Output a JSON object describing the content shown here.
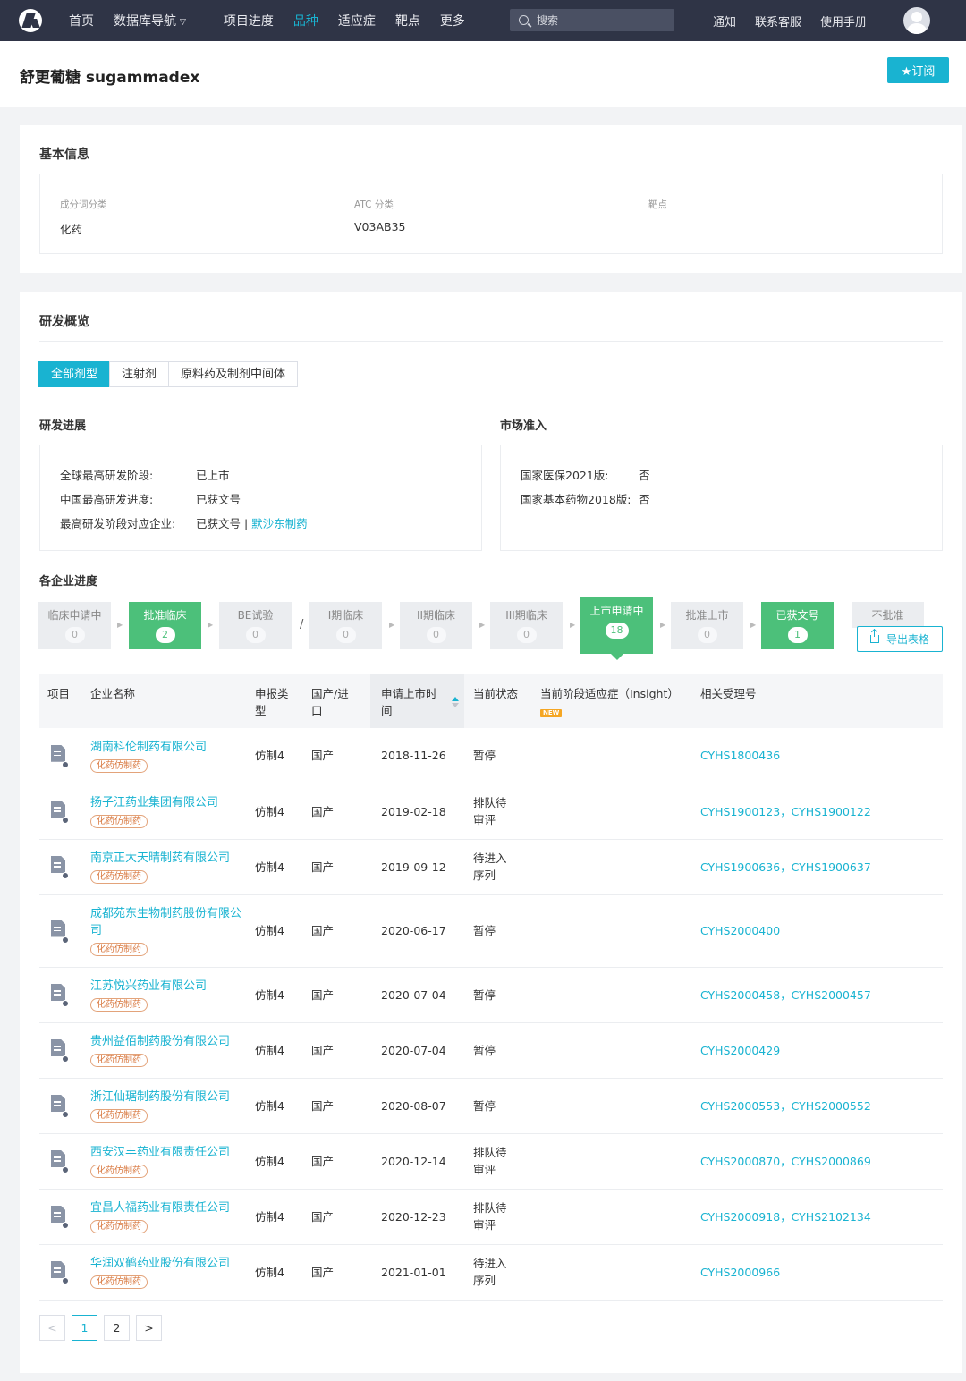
{
  "nav": {
    "items": [
      "首页",
      "数据库导航",
      "项目进度",
      "品种",
      "适应症",
      "靶点",
      "更多"
    ],
    "active_index": 3,
    "search_placeholder": "搜索",
    "right_items": [
      "通知",
      "联系客服",
      "使用手册"
    ]
  },
  "header": {
    "title": "舒更葡糖 sugammadex",
    "subscribe_label": "★订阅"
  },
  "basic_info": {
    "title": "基本信息",
    "fields": [
      {
        "label": "成分词分类",
        "value": "化药"
      },
      {
        "label": "ATC 分类",
        "value": "V03AB35"
      },
      {
        "label": "靶点",
        "value": ""
      }
    ]
  },
  "rd_overview": {
    "title": "研发概览",
    "tabs": [
      "全部剂型",
      "注射剂",
      "原料药及制剂中间体"
    ],
    "active_tab": 0,
    "progress": {
      "title": "研发进展",
      "rows": [
        {
          "label": "全球最高研发阶段:",
          "value": "已上市"
        },
        {
          "label": "中国最高研发进度:",
          "value": "已获文号"
        },
        {
          "label": "最高研发阶段对应企业:",
          "value": "已获文号 | ",
          "link": "默沙东制药"
        }
      ]
    },
    "market": {
      "title": "市场准入",
      "rows": [
        {
          "label": "国家医保2021版:",
          "value": "否"
        },
        {
          "label": "国家基本药物2018版:",
          "value": "否"
        }
      ]
    },
    "company_progress_title": "各企业进度",
    "stages": [
      {
        "name": "临床申请中",
        "count": "0",
        "state": "grey"
      },
      {
        "name": "批准临床",
        "count": "2",
        "state": "green"
      },
      {
        "name": "BE试验",
        "count": "0",
        "state": "grey"
      },
      {
        "name": "I期临床",
        "count": "0",
        "state": "grey"
      },
      {
        "name": "II期临床",
        "count": "0",
        "state": "grey"
      },
      {
        "name": "III期临床",
        "count": "0",
        "state": "grey"
      },
      {
        "name": "上市申请中",
        "count": "18",
        "state": "selected"
      },
      {
        "name": "批准上市",
        "count": "0",
        "state": "grey"
      },
      {
        "name": "已获文号",
        "count": "1",
        "state": "green"
      },
      {
        "name": "不批准",
        "count": "",
        "state": "grey"
      }
    ],
    "slash": "/",
    "export_label": "导出表格"
  },
  "table": {
    "headers": [
      "项目",
      "企业名称",
      "申报类型",
      "国产/进口",
      "申请上市时间",
      "当前状态",
      "当前阶段适应症（Insight）",
      "相关受理号"
    ],
    "new_badge": "NEW",
    "rows": [
      {
        "company": "湖南科伦制药有限公司",
        "tag": "化药仿制药",
        "type": "仿制4",
        "origin": "国产",
        "date": "2018-11-26",
        "status": "暂停",
        "indication": "",
        "codes": "CYHS1800436"
      },
      {
        "company": "扬子江药业集团有限公司",
        "tag": "化药仿制药",
        "type": "仿制4",
        "origin": "国产",
        "date": "2019-02-18",
        "status": "排队待审评",
        "indication": "",
        "codes": "CYHS1900123，CYHS1900122"
      },
      {
        "company": "南京正大天晴制药有限公司",
        "tag": "化药仿制药",
        "type": "仿制4",
        "origin": "国产",
        "date": "2019-09-12",
        "status": "待进入序列",
        "indication": "",
        "codes": "CYHS1900636，CYHS1900637"
      },
      {
        "company": "成都苑东生物制药股份有限公司",
        "tag": "化药仿制药",
        "type": "仿制4",
        "origin": "国产",
        "date": "2020-06-17",
        "status": "暂停",
        "indication": "",
        "codes": "CYHS2000400"
      },
      {
        "company": "江苏悦兴药业有限公司",
        "tag": "化药仿制药",
        "type": "仿制4",
        "origin": "国产",
        "date": "2020-07-04",
        "status": "暂停",
        "indication": "",
        "codes": "CYHS2000458，CYHS2000457"
      },
      {
        "company": "贵州益佰制药股份有限公司",
        "tag": "化药仿制药",
        "type": "仿制4",
        "origin": "国产",
        "date": "2020-07-04",
        "status": "暂停",
        "indication": "",
        "codes": "CYHS2000429"
      },
      {
        "company": "浙江仙琚制药股份有限公司",
        "tag": "化药仿制药",
        "type": "仿制4",
        "origin": "国产",
        "date": "2020-08-07",
        "status": "暂停",
        "indication": "",
        "codes": "CYHS2000553，CYHS2000552"
      },
      {
        "company": "西安汉丰药业有限责任公司",
        "tag": "化药仿制药",
        "type": "仿制4",
        "origin": "国产",
        "date": "2020-12-14",
        "status": "排队待审评",
        "indication": "",
        "codes": "CYHS2000870，CYHS2000869"
      },
      {
        "company": "宜昌人福药业有限责任公司",
        "tag": "化药仿制药",
        "type": "仿制4",
        "origin": "国产",
        "date": "2020-12-23",
        "status": "排队待审评",
        "indication": "",
        "codes": "CYHS2000918，CYHS2102134"
      },
      {
        "company": "华润双鹤药业股份有限公司",
        "tag": "化药仿制药",
        "type": "仿制4",
        "origin": "国产",
        "date": "2021-01-01",
        "status": "待进入序列",
        "indication": "",
        "codes": "CYHS2000966"
      }
    ]
  },
  "pagination": {
    "prev": "<",
    "pages": [
      "1",
      "2"
    ],
    "active_page": "1",
    "next": ">"
  },
  "colors": {
    "accent": "#19b3d1",
    "nav_bg": "#2f3446",
    "stage_green": "#4cc07a",
    "tag_orange": "#d97a42"
  }
}
